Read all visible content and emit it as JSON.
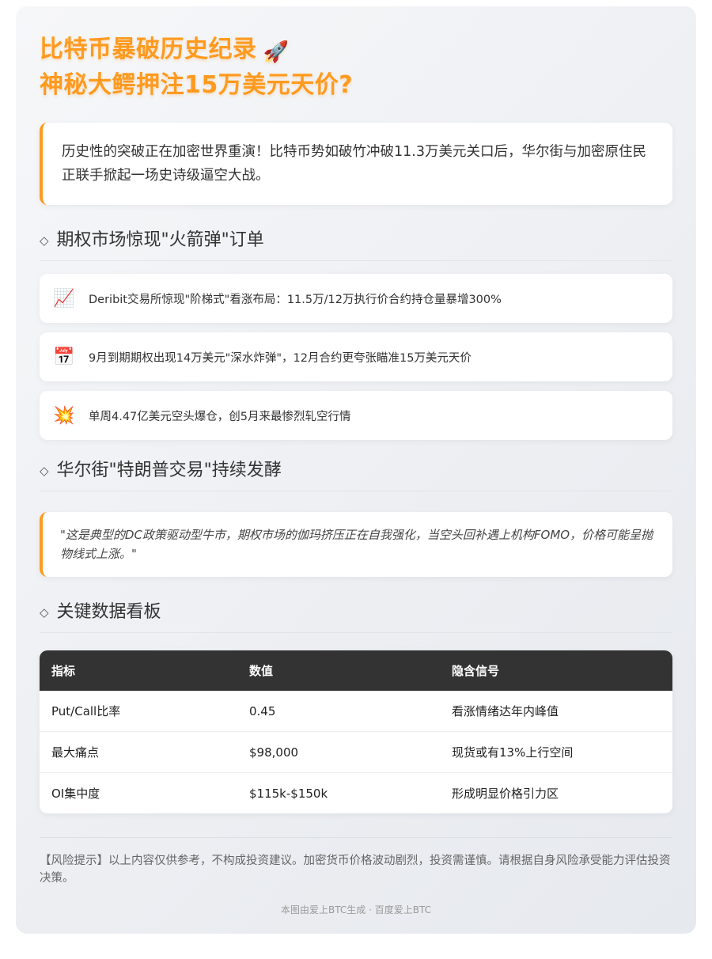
{
  "title": {
    "line1": "比特币暴破历史纪录",
    "rocket_icon": "🚀",
    "line2": "神秘大鳄押注15万美元天价?"
  },
  "intro": "历史性的突破正在加密世界重演！比特币势如破竹冲破11.3万美元关口后，华尔街与加密原住民正联手掀起一场史诗级逼空大战。",
  "sections": {
    "options": {
      "title": "期权市场惊现\"火箭弹\"订单",
      "items": [
        {
          "icon": "chart-increasing-icon",
          "glyph": "📈",
          "text": "Deribit交易所惊现\"阶梯式\"看涨布局：11.5万/12万执行价合约持仓量暴增300%"
        },
        {
          "icon": "calendar-icon",
          "glyph": "📅",
          "text": "9月到期期权出现14万美元\"深水炸弹\"，12月合约更夸张瞄准15万美元天价"
        },
        {
          "icon": "collision-icon",
          "glyph": "💥",
          "text": "单周4.47亿美元空头爆仓，创5月来最惨烈轧空行情"
        }
      ]
    },
    "wallstreet": {
      "title": "华尔街\"特朗普交易\"持续发酵",
      "quote": "\"这是典型的DC政策驱动型牛市，期权市场的伽玛挤压正在自我强化，当空头回补遇上机构FOMO，价格可能呈抛物线式上涨。\""
    },
    "dashboard": {
      "title": "关键数据看板",
      "headers": [
        "指标",
        "数值",
        "隐含信号"
      ],
      "rows": [
        [
          "Put/Call比率",
          "0.45",
          "看涨情绪达年内峰值"
        ],
        [
          "最大痛点",
          "$98,000",
          "现货或有13%上行空间"
        ],
        [
          "OI集中度",
          "$115k-$150k",
          "形成明显价格引力区"
        ]
      ]
    }
  },
  "section_marker": "◇",
  "risk_notice": "【风险提示】以上内容仅供参考，不构成投资建议。加密货币价格波动剧烈，投资需谨慎。请根据自身风险承受能力评估投资决策。",
  "footer": "本图由爱上BTC生成 · 百度爱上BTC",
  "colors": {
    "accent": "#ff9a1f",
    "table_header": "#333333"
  }
}
